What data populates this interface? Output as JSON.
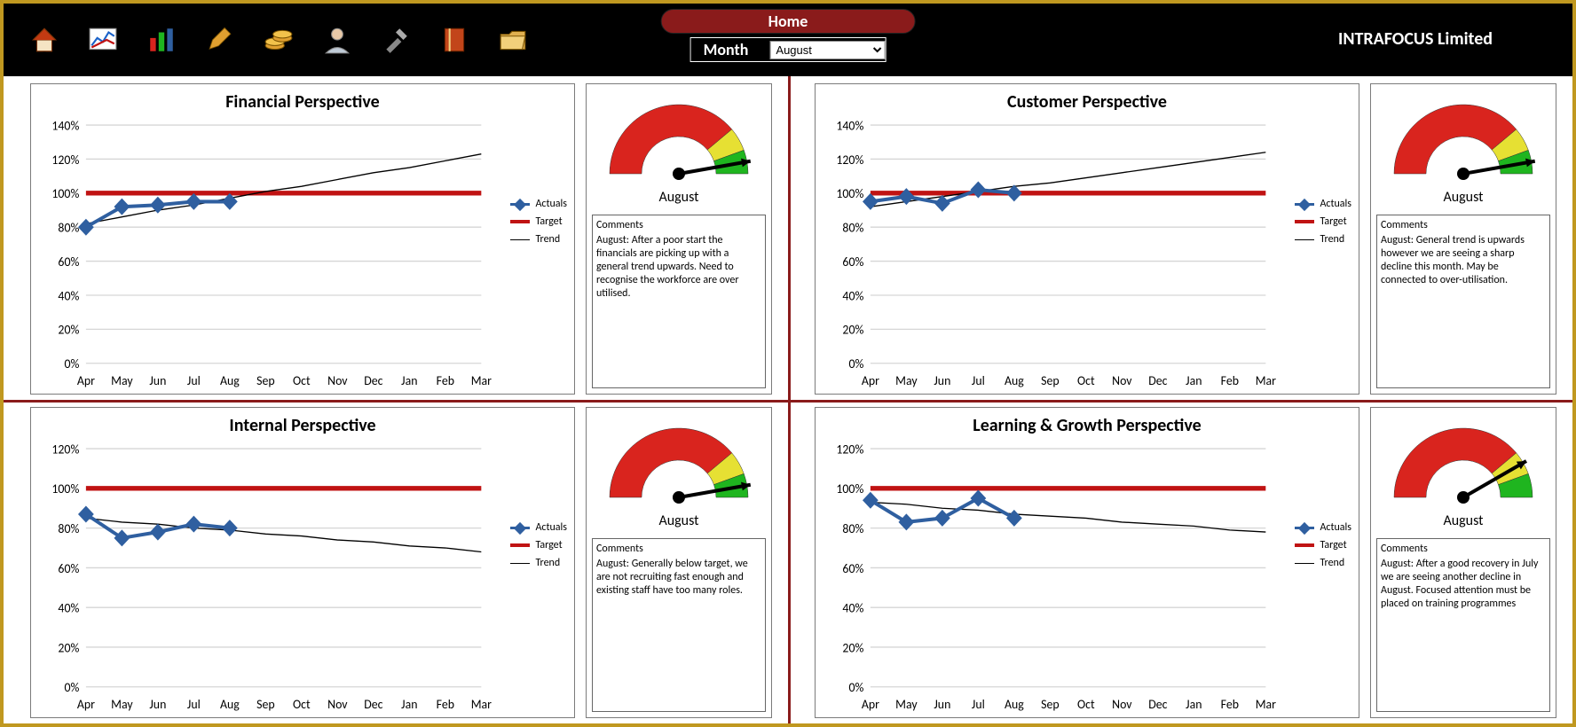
{
  "header": {
    "home_label": "Home",
    "month_label": "Month",
    "month_value": "August",
    "company": "INTRAFOCUS Limited"
  },
  "legend": {
    "actuals": "Actuals",
    "target": "Target",
    "trend": "Trend"
  },
  "months": [
    "Apr",
    "May",
    "Jun",
    "Jul",
    "Aug",
    "Sep",
    "Oct",
    "Nov",
    "Dec",
    "Jan",
    "Feb",
    "Mar"
  ],
  "panels": {
    "financial": {
      "title": "Financial Perspective",
      "gauge_month": "August",
      "gauge_zone": "green",
      "comments_heading": "Comments",
      "comments": "August: After a poor start the financials are picking up with a general trend upwards.  Need to recognise the workforce are over utilised."
    },
    "customer": {
      "title": "Customer Perspective",
      "gauge_month": "August",
      "gauge_zone": "green",
      "comments_heading": "Comments",
      "comments": "August: General trend is upwards however we are seeing a sharp decline this month.  May be connected to over-utilisation."
    },
    "internal": {
      "title": "Internal Perspective",
      "gauge_month": "August",
      "gauge_zone": "green",
      "comments_heading": "Comments",
      "comments": "August: Generally below target, we are not recruiting fast enough and existing staff have too many roles."
    },
    "learning": {
      "title": "Learning & Growth Perspective",
      "gauge_month": "August",
      "gauge_zone": "yellow",
      "comments_heading": "Comments",
      "comments": "August: After a good recovery in July we are seeing another decline in August.  Focused attention must be placed on training programmes"
    }
  },
  "chart_data": [
    {
      "id": "financial",
      "type": "line",
      "title": "Financial Perspective",
      "xlabel": "",
      "ylabel": "",
      "ylim": [
        0,
        140
      ],
      "yticks": [
        0,
        20,
        40,
        60,
        80,
        100,
        120,
        140
      ],
      "categories": [
        "Apr",
        "May",
        "Jun",
        "Jul",
        "Aug",
        "Sep",
        "Oct",
        "Nov",
        "Dec",
        "Jan",
        "Feb",
        "Mar"
      ],
      "series": [
        {
          "name": "Actuals",
          "values": [
            80,
            92,
            93,
            95,
            95,
            null,
            null,
            null,
            null,
            null,
            null,
            null
          ]
        },
        {
          "name": "Target",
          "values": [
            100,
            100,
            100,
            100,
            100,
            100,
            100,
            100,
            100,
            100,
            100,
            100
          ]
        },
        {
          "name": "Trend",
          "values": [
            82,
            86,
            90,
            93,
            97,
            101,
            104,
            108,
            112,
            115,
            119,
            123
          ]
        }
      ]
    },
    {
      "id": "customer",
      "type": "line",
      "title": "Customer Perspective",
      "xlabel": "",
      "ylabel": "",
      "ylim": [
        0,
        140
      ],
      "yticks": [
        0,
        20,
        40,
        60,
        80,
        100,
        120,
        140
      ],
      "categories": [
        "Apr",
        "May",
        "Jun",
        "Jul",
        "Aug",
        "Sep",
        "Oct",
        "Nov",
        "Dec",
        "Jan",
        "Feb",
        "Mar"
      ],
      "series": [
        {
          "name": "Actuals",
          "values": [
            95,
            98,
            94,
            102,
            100,
            null,
            null,
            null,
            null,
            null,
            null,
            null
          ]
        },
        {
          "name": "Target",
          "values": [
            100,
            100,
            100,
            100,
            100,
            100,
            100,
            100,
            100,
            100,
            100,
            100
          ]
        },
        {
          "name": "Trend",
          "values": [
            92,
            95,
            98,
            101,
            104,
            106,
            109,
            112,
            115,
            118,
            121,
            124
          ]
        }
      ]
    },
    {
      "id": "internal",
      "type": "line",
      "title": "Internal Perspective",
      "xlabel": "",
      "ylabel": "",
      "ylim": [
        0,
        120
      ],
      "yticks": [
        0,
        20,
        40,
        60,
        80,
        100,
        120
      ],
      "categories": [
        "Apr",
        "May",
        "Jun",
        "Jul",
        "Aug",
        "Sep",
        "Oct",
        "Nov",
        "Dec",
        "Jan",
        "Feb",
        "Mar"
      ],
      "series": [
        {
          "name": "Actuals",
          "values": [
            87,
            75,
            78,
            82,
            80,
            null,
            null,
            null,
            null,
            null,
            null,
            null
          ]
        },
        {
          "name": "Target",
          "values": [
            100,
            100,
            100,
            100,
            100,
            100,
            100,
            100,
            100,
            100,
            100,
            100
          ]
        },
        {
          "name": "Trend",
          "values": [
            85,
            83,
            82,
            80,
            79,
            77,
            76,
            74,
            73,
            71,
            70,
            68
          ]
        }
      ]
    },
    {
      "id": "learning",
      "type": "line",
      "title": "Learning & Growth Perspective",
      "xlabel": "",
      "ylabel": "",
      "ylim": [
        0,
        120
      ],
      "yticks": [
        0,
        20,
        40,
        60,
        80,
        100,
        120
      ],
      "categories": [
        "Apr",
        "May",
        "Jun",
        "Jul",
        "Aug",
        "Sep",
        "Oct",
        "Nov",
        "Dec",
        "Jan",
        "Feb",
        "Mar"
      ],
      "series": [
        {
          "name": "Actuals",
          "values": [
            94,
            83,
            85,
            95,
            85,
            null,
            null,
            null,
            null,
            null,
            null,
            null
          ]
        },
        {
          "name": "Target",
          "values": [
            100,
            100,
            100,
            100,
            100,
            100,
            100,
            100,
            100,
            100,
            100,
            100
          ]
        },
        {
          "name": "Trend",
          "values": [
            93,
            92,
            90,
            89,
            87,
            86,
            85,
            83,
            82,
            81,
            79,
            78
          ]
        }
      ]
    }
  ]
}
